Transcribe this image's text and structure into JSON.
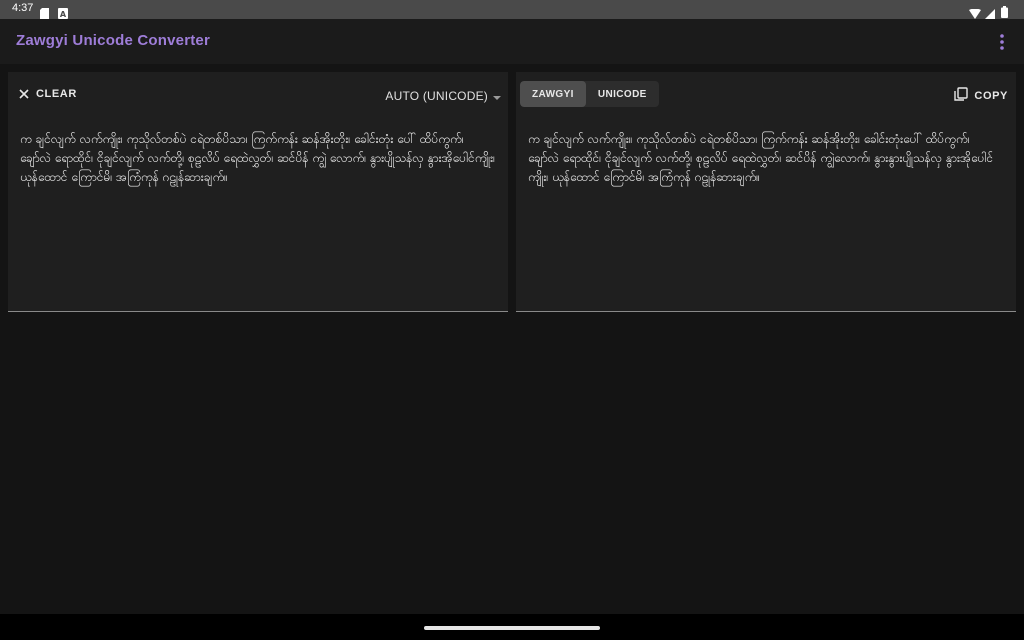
{
  "status_bar": {
    "time": "4:37"
  },
  "app_bar": {
    "title": "Zawgyi Unicode Converter",
    "overflow_icon": "more-vert-icon"
  },
  "input_panel": {
    "clear_label": "CLEAR",
    "clear_icon": "close-icon",
    "encoding_select": "AUTO (UNICODE)",
    "text": "က ချင်လျက် လက်ကျိုး၊ ကုသိုလ်တစ်ပဲ ငရဲတစ်ပိသာ၊ ကြက်ကန်း ဆန်အိုးတိုး၊ ခေါင်းတုံး ပေါ် ထိပ်ကွက်၊ ချော်လဲ ရောထိုင်၊ ငိုချင်လျက် လက်တို့၊ စုဠလိပ် ရေထဲလွှတ်၊ ဆင်ပိန် ကျွဲ လောက်၊ နွားပျိုသန်လှ နွားအိုပေါင်ကျိုး၊ ယုန်ထောင် ကြောင်မိ၊ အကြံကုန် ဂဠုန်ဆားချက်။"
  },
  "output_panel": {
    "tabs": [
      {
        "label": "ZAWGYI",
        "active": true
      },
      {
        "label": "UNICODE",
        "active": false
      }
    ],
    "copy_label": "COPY",
    "copy_icon": "copy-icon",
    "text": "က ချင်လျက် လက်ကျိုး။ ကုသိုလ်တစ်ပဲ ငရဲတစ်ပိသာ၊ ကြက်ကန်း ဆန်အိုးတိုး၊ ခေါင်းတုံးပေါ် ထိပ်ကွက်၊ ချော်လဲ ရောထိုင်၊ ငိုချင်လျက် လက်တို့၊ စုဠလိပ် ရေထဲလွှတ်၊ ဆင်ပိန် ကျွဲလောက်၊ နွားနွားပျိုသန်လှ နွားအိုပေါင်ကျိုး၊ ယုန်ထောင် ကြောင်မိ၊ အကြံကုန် ဂဠုန်ဆားချက်။"
  },
  "colors": {
    "accent": "#9e7dd8",
    "background": "#141414",
    "panel": "#1f1f1f"
  }
}
